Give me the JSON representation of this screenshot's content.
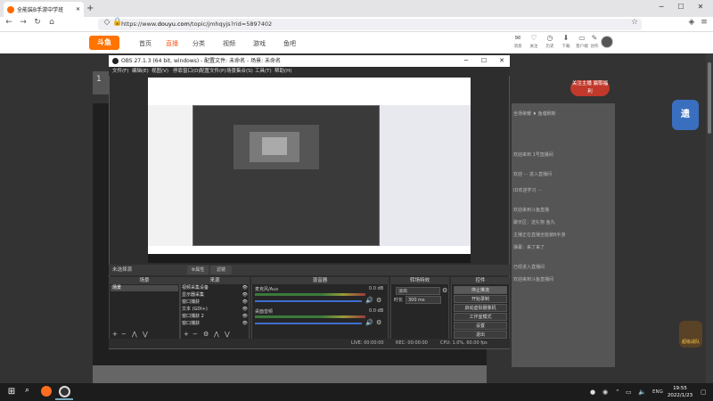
{
  "browser": {
    "tab_title": "全能装B手游中学班",
    "new_tab": "+",
    "url_prefix": "https://www.",
    "url_domain": "douyu.com",
    "url_rest": "/topic/jmhqyjs?rid=5897402"
  },
  "douyu": {
    "logo": "斗鱼",
    "nav": [
      "首页",
      "直播",
      "分类",
      "视频",
      "游戏",
      "鱼吧"
    ],
    "header_icons": [
      "消息",
      "关注",
      "历史",
      "下载",
      "客户端",
      "创作"
    ],
    "info_num": "1",
    "subscribe_btn": "关注主播\n赢取福利",
    "side_badge": "遗",
    "side_badge2": "超级战队",
    "chat_lines": [
      "全场荣耀 ♦ 鱼塘刷新",
      "欢迎来到 1号直播间",
      "欢迎 ··· 进入直播间",
      "ID欢迎学习 ···",
      "欢迎来到斗鱼直播",
      "聊天区：送礼物 鱼丸",
      "主播正在直播全能装B手游",
      "弹幕：来了来了",
      "已经进入直播间",
      "欢迎来到斗鱼直播间"
    ]
  },
  "obs": {
    "title": "OBS 27.1.3 (64 bit, windows) - 配置文件: 未命名 - 场景: 未命名",
    "menu": [
      "文件(F)",
      "编辑(E)",
      "视图(V)",
      "停靠窗口(D)",
      "配置文件(P)",
      "场景集合(S)",
      "工具(T)",
      "帮助(H)"
    ],
    "scene_bar": "未选择源",
    "cfg_btn": "⚙属性",
    "filter_btn": "滤镜",
    "docks": {
      "scenes": "场景",
      "sources": "来源",
      "mixer": "混音器",
      "transitions": "转场特效",
      "controls": "控件"
    },
    "scene_item": "场景",
    "sources": [
      "视频采集设备",
      "显示器采集",
      "窗口捕获",
      "文本 (GDI+)",
      "窗口捕获 2",
      "窗口捕获"
    ],
    "mixer": [
      {
        "name": "麦克风/Aux",
        "db": "0.0 dB"
      },
      {
        "name": "桌面音频",
        "db": "0.0 dB"
      }
    ],
    "transition": "淡出",
    "duration_label": "时长",
    "duration": "300 ms",
    "controls": [
      "停止推流",
      "开始录制",
      "启动虚拟摄像机",
      "工作室模式",
      "设置",
      "退出"
    ],
    "status": {
      "live": "LIVE: 00:00:00",
      "rec": "REC: 00:00:00",
      "cpu": "CPU: 1.0%, 60.00 fps"
    }
  },
  "taskbar": {
    "lang": "ENG",
    "time": "19:55",
    "date": "2022/1/23"
  }
}
